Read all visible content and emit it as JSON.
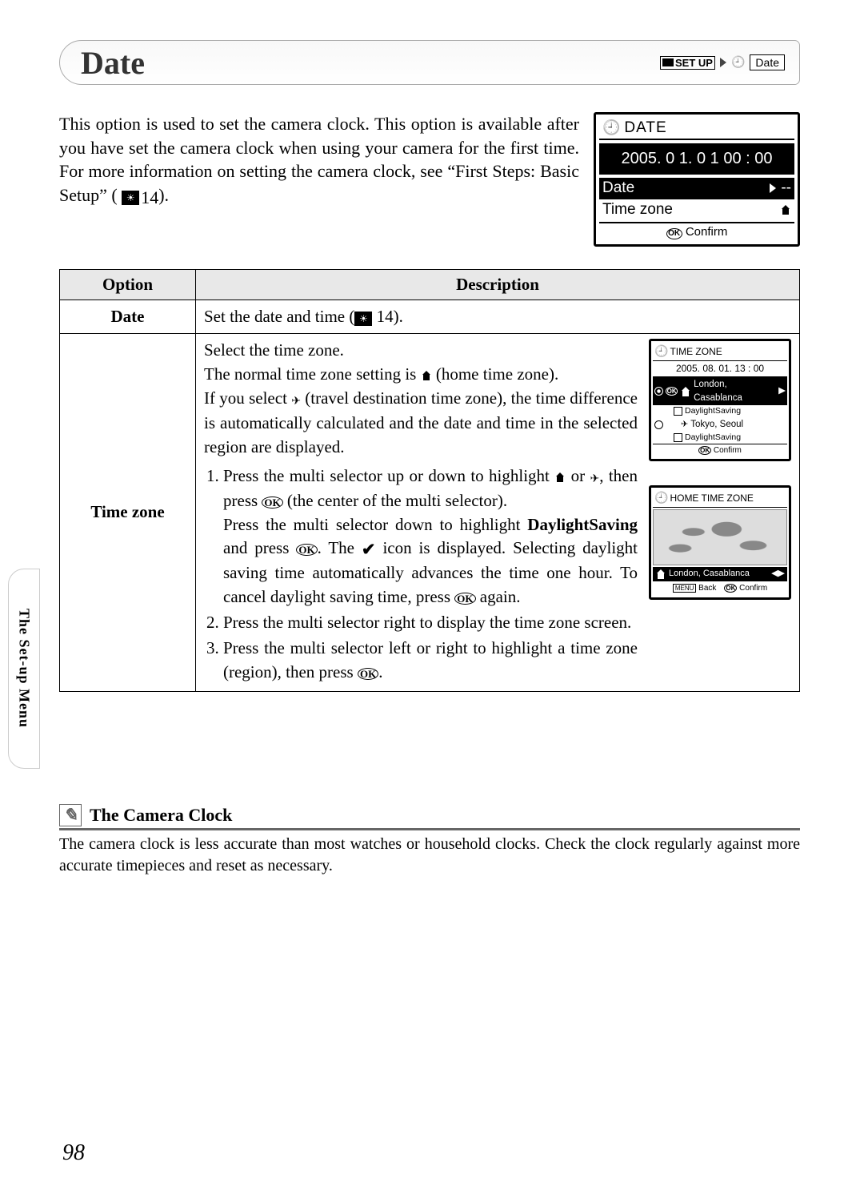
{
  "side_tab": "The Set-up Menu",
  "header": {
    "title": "Date",
    "path_setup": "SET UP",
    "path_leaf": "Date"
  },
  "intro": {
    "text": "This option is used to set the camera clock. This option is available after you have set the camera clock when using your camera for the first time. For more information on setting the camera clock, see “First Steps: Basic Setup” (",
    "page_ref": "14",
    "text_close": ")."
  },
  "main_screen": {
    "title": "DATE",
    "timestamp": "2005. 0 1. 0 1  00 : 00",
    "row_date": "Date",
    "row_date_val": "--",
    "row_tz": "Time zone",
    "footer": "Confirm"
  },
  "table": {
    "head_option": "Option",
    "head_desc": "Description",
    "row1_opt": "Date",
    "row1_desc_a": "Set the date and time (",
    "row1_ref": "14",
    "row1_desc_b": ").",
    "row2_opt": "Time zone",
    "row2_p1": "Select the time zone.",
    "row2_p2a": "The normal time zone setting is ",
    "row2_p2b": " (home time zone).",
    "row2_p3a": "If you select ",
    "row2_p3b": " (travel destination time zone), the time difference is automatically calculated and the date and time in the selected region are displayed.",
    "row2_li1a": "Press the multi selector up or down to highlight ",
    "row2_li1b": " or ",
    "row2_li1c": ", then press ",
    "row2_li1d": " (the center of the multi selector).",
    "row2_li1e": "Press the multi selector down to highlight ",
    "row2_li1_bold": "DaylightSaving",
    "row2_li1f": " and press ",
    "row2_li1g": ". The ",
    "row2_li1h": " icon is displayed. Selecting daylight saving time automatically advances the time one hour. To cancel daylight saving time, press ",
    "row2_li1i": " again.",
    "row2_li2": "Press the multi selector right to display the time zone screen.",
    "row2_li3a": "Press the multi selector left or right to highlight a time zone (region), then press ",
    "row2_li3b": "."
  },
  "tz_screen": {
    "title": "TIME ZONE",
    "timestamp": "2005. 08. 01.  13 : 00",
    "home": "London, Casablanca",
    "ds": "DaylightSaving",
    "travel": "Tokyo, Seoul",
    "confirm": "Confirm"
  },
  "map_screen": {
    "title": "HOME TIME ZONE",
    "loc": "London, Casablanca",
    "back": "Back",
    "confirm": "Confirm"
  },
  "note": {
    "title": "The Camera Clock",
    "body": "The camera clock is less accurate than most watches or household clocks. Check the clock regularly against more accurate timepieces and reset as necessary."
  },
  "page_number": "98"
}
